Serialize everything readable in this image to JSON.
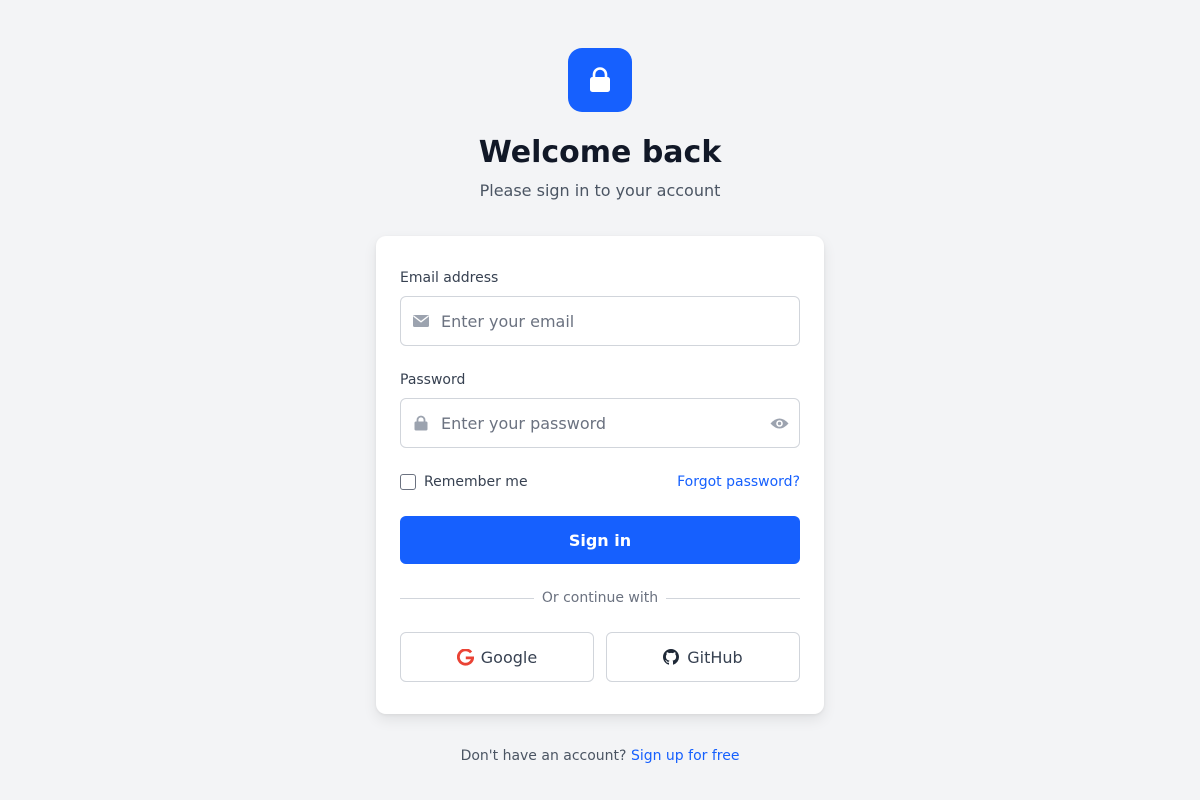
{
  "header": {
    "logo_icon": "lock-icon",
    "title": "Welcome back",
    "subtitle": "Please sign in to your account"
  },
  "form": {
    "email": {
      "label": "Email address",
      "placeholder": "Enter your email",
      "value": "",
      "icon": "envelope-icon"
    },
    "password": {
      "label": "Password",
      "placeholder": "Enter your password",
      "value": "",
      "icon": "lock-icon",
      "toggle_icon": "eye-icon"
    },
    "remember_label": "Remember me",
    "remember_checked": false,
    "forgot_label": "Forgot password?",
    "submit_label": "Sign in",
    "divider_text": "Or continue with",
    "social": [
      {
        "label": "Google",
        "icon": "google-icon"
      },
      {
        "label": "GitHub",
        "icon": "github-icon"
      }
    ]
  },
  "footer": {
    "prompt": "Don't have an account?",
    "signup_label": "Sign up for free"
  },
  "colors": {
    "accent": "#1660fe",
    "background": "#f3f4f6",
    "card": "#ffffff",
    "google_red": "#ea4335"
  }
}
